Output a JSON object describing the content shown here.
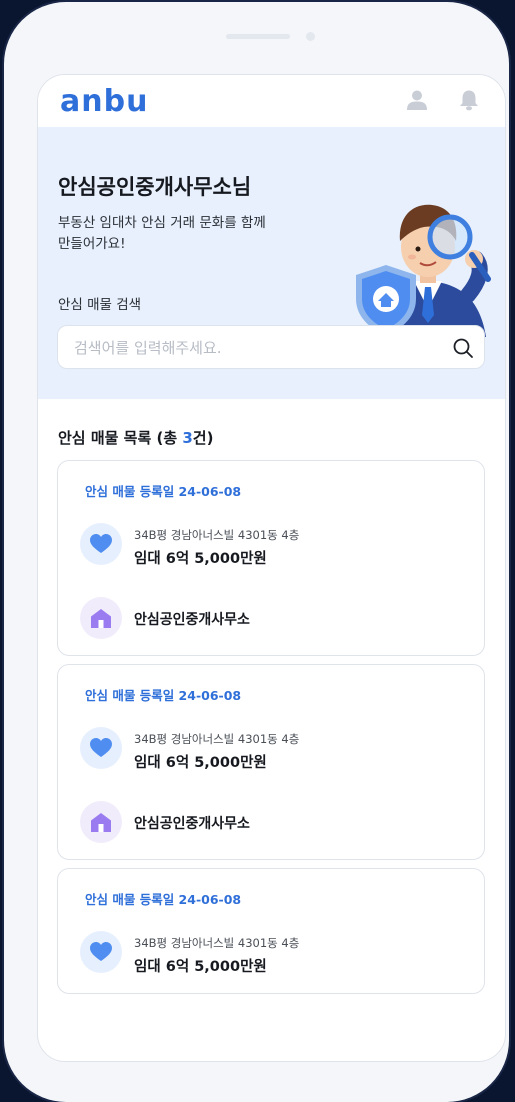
{
  "header": {
    "logo": "anbu",
    "icons": [
      "user-icon",
      "bell-icon"
    ]
  },
  "hero": {
    "title": "안심공인중개사무소님",
    "subtitle": "부동산 임대차 안심 거래 문화를 함께 만들어가요!",
    "search_label": "안심 매물 검색",
    "search_placeholder": "검색어를 입력해주세요."
  },
  "list": {
    "title_prefix": "안심 매물 목록 (총 ",
    "count": "3",
    "title_suffix": "건)",
    "items": [
      {
        "date_label": "안심 매물 등록일 24-06-08",
        "address": "34B평 경남아너스빌 4301동 4층",
        "price": "임대 6억 5,000만원",
        "agency": "안심공인중개사무소"
      },
      {
        "date_label": "안심 매물 등록일 24-06-08",
        "address": "34B평 경남아너스빌 4301동 4층",
        "price": "임대 6억 5,000만원",
        "agency": "안심공인중개사무소"
      },
      {
        "date_label": "안심 매물 등록일 24-06-08",
        "address": "34B평 경남아너스빌 4301동 4층",
        "price": "임대 6억 5,000만원"
      }
    ]
  },
  "colors": {
    "accent": "#2f6fd9",
    "hero_bg": "#e7f0fc",
    "heart": "#4f8ef0",
    "house": "#9a7cf0"
  }
}
